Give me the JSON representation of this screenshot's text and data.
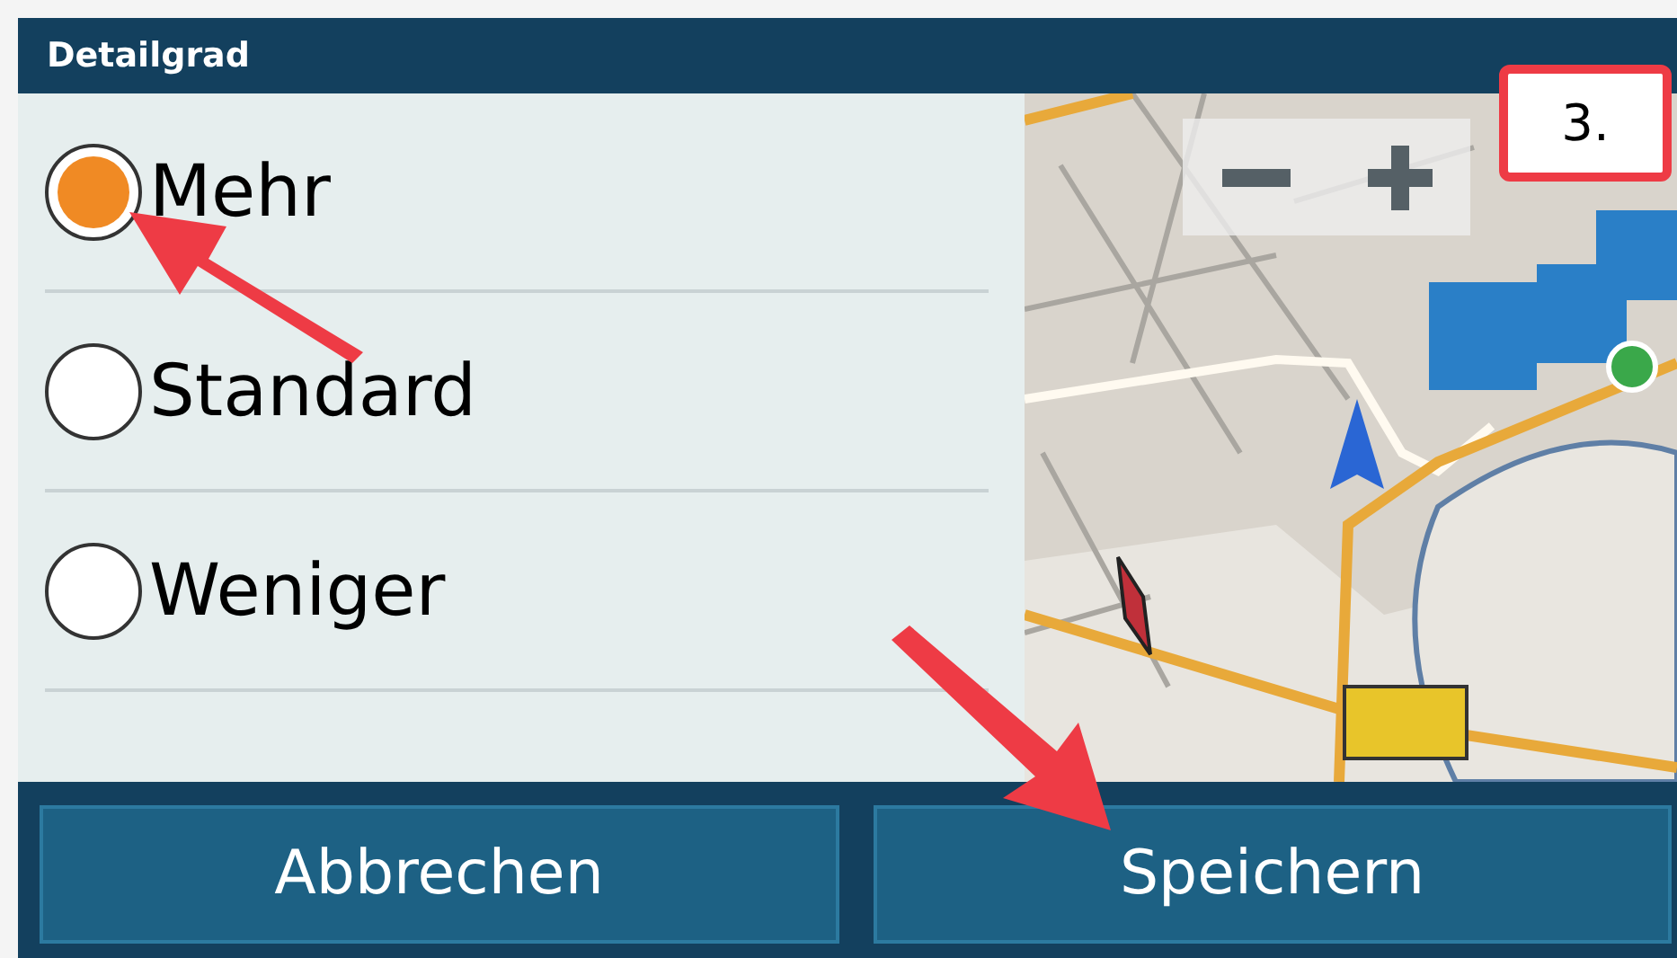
{
  "title": "Detailgrad",
  "options": [
    {
      "label": "Mehr",
      "selected": true
    },
    {
      "label": "Standard",
      "selected": false
    },
    {
      "label": "Weniger",
      "selected": false
    }
  ],
  "map": {
    "kind": "picture"
  },
  "annotation": "3.",
  "buttons": [
    "Abbrechen",
    "Speichern"
  ]
}
